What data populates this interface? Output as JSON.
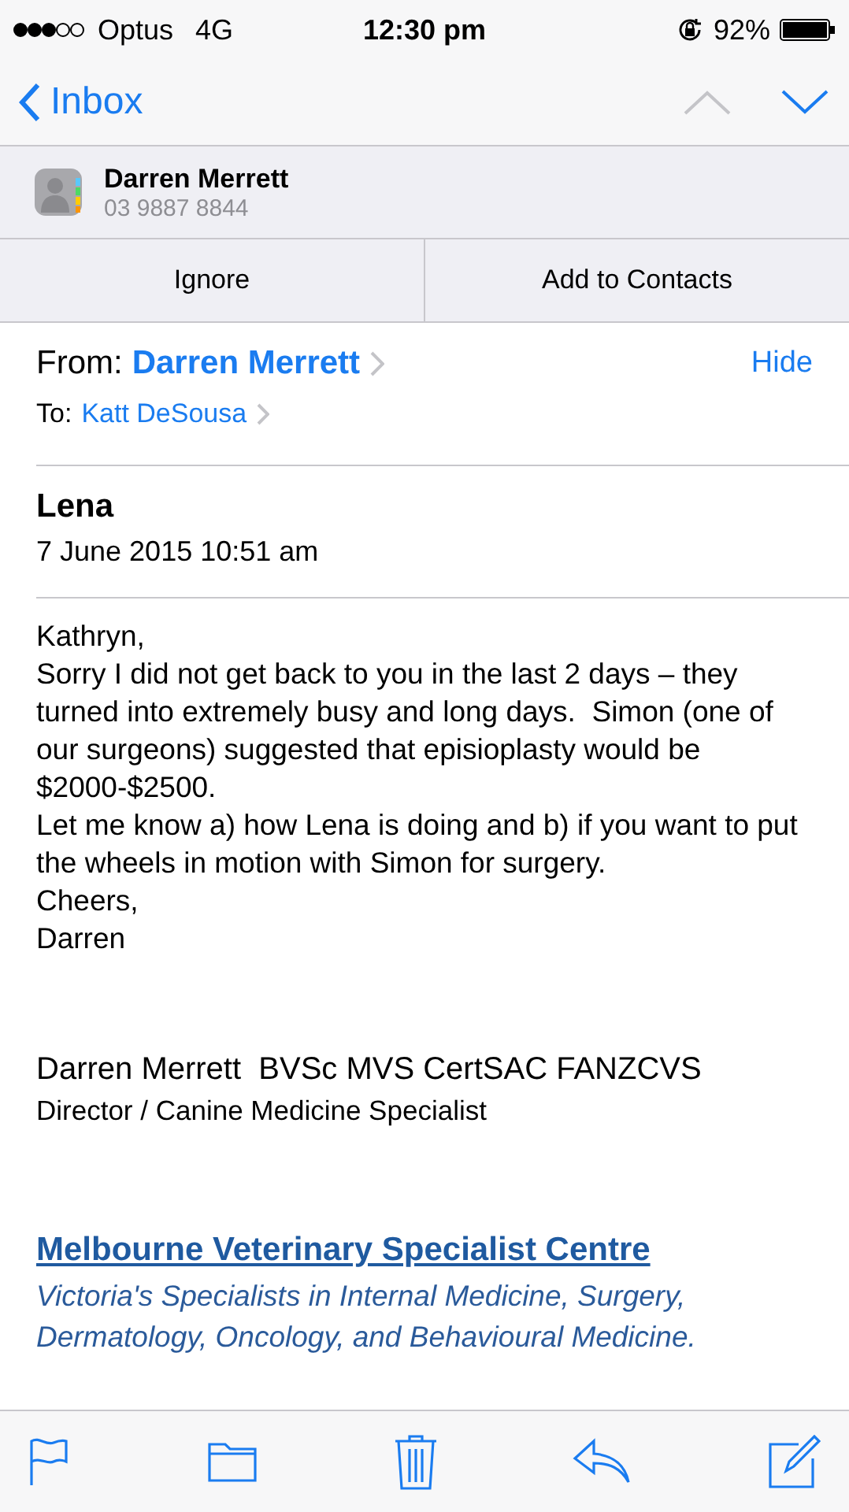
{
  "status_bar": {
    "carrier": "Optus",
    "network": "4G",
    "time": "12:30 pm",
    "battery": "92%"
  },
  "nav": {
    "back": "Inbox",
    "previous_disabled": true,
    "next_disabled": false
  },
  "contact_banner": {
    "name": "Darren Merrett",
    "phone": "03 9887 8844",
    "actions": [
      "Ignore",
      "Add to Contacts"
    ]
  },
  "header": {
    "from_label": "From:",
    "from": "Darren Merrett",
    "hide": "Hide",
    "to_label": "To:",
    "to": "Katt DeSousa"
  },
  "subject": {
    "title": "Lena",
    "date": "7 June 2015 10:51 am"
  },
  "body": [
    "Kathryn,",
    "Sorry I did not get back to you in the last 2 days – they turned into extremely busy and long days.  Simon (one of our surgeons) suggested that episioplasty would be $2000-$2500.",
    "Let me know a) how Lena is doing and b) if you want to put the wheels in motion with Simon for surgery.",
    "Cheers,",
    "Darren"
  ],
  "signature": {
    "name": "Darren Merrett  BVSc MVS CertSAC FANZCVS",
    "role": "Director / Canine Medicine Specialist",
    "link": "Melbourne Veterinary Specialist Centre",
    "tagline": "Victoria's Specialists in Internal Medicine, Surgery, Dermatology, Oncology, and Behavioural Medicine."
  }
}
